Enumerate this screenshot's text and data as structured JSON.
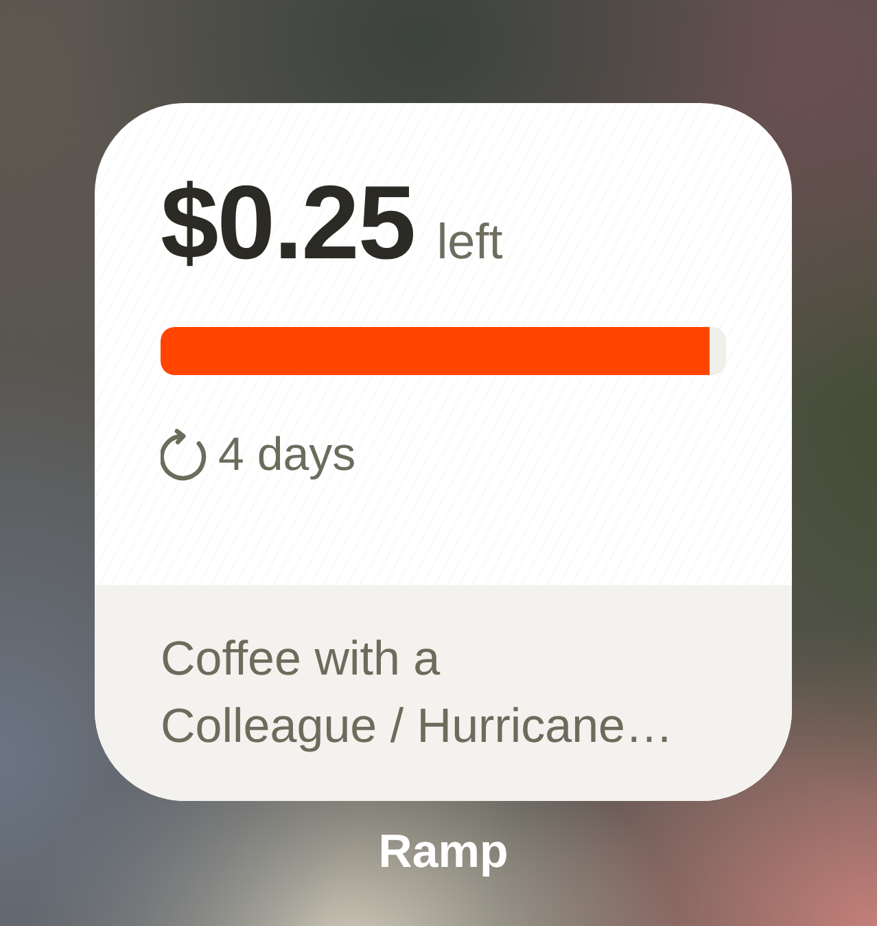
{
  "widget": {
    "amount": "$0.25",
    "amount_suffix": "left",
    "progress": {
      "level": 0.97
    },
    "reset_period": "4 days",
    "description": "Coffee with a\nColleague / Hurricane…"
  },
  "app_label": "Ramp"
}
